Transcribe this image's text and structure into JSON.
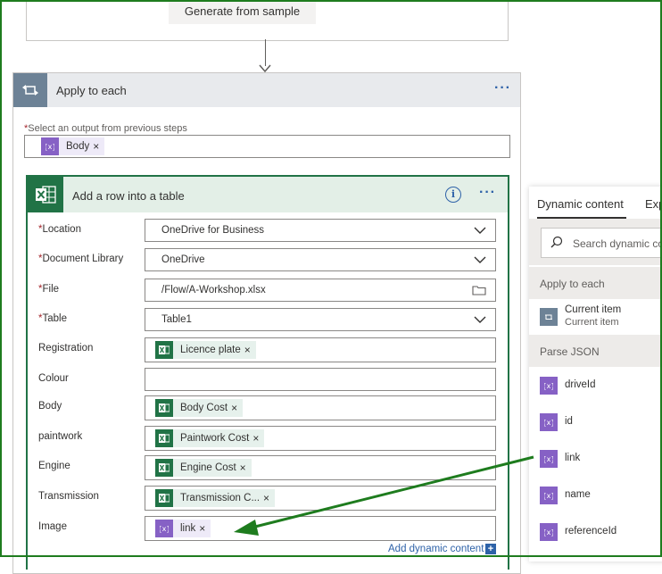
{
  "top_card": {
    "generate_label": "Generate from sample"
  },
  "apply_each": {
    "title": "Apply to each",
    "more_label": "···",
    "select_label": "Select an output from previous steps",
    "required_mark": "*",
    "token": {
      "label": "Body",
      "remove": "×"
    }
  },
  "add_row": {
    "title": "Add a row into a table",
    "info_label": "i",
    "more_label": "···",
    "fields": {
      "location": {
        "label": "Location",
        "value": "OneDrive for Business"
      },
      "document_library": {
        "label": "Document Library",
        "value": "OneDrive"
      },
      "file": {
        "label": "File",
        "value": "/Flow/A-Workshop.xlsx"
      },
      "table": {
        "label": "Table",
        "value": "Table1"
      },
      "registration": {
        "label": "Registration",
        "token": "Licence plate"
      },
      "colour": {
        "label": "Colour",
        "value": ""
      },
      "body": {
        "label": "Body",
        "token": "Body Cost"
      },
      "paintwork": {
        "label": "paintwork",
        "token": "Paintwork Cost"
      },
      "engine": {
        "label": "Engine",
        "token": "Engine Cost"
      },
      "transmission": {
        "label": "Transmission",
        "token": "Transmission C..."
      },
      "image": {
        "label": "Image",
        "token": "link"
      }
    },
    "token_remove": "×",
    "add_dynamic_label": "Add dynamic content",
    "add_plus": "+"
  },
  "dynamic_panel": {
    "tab_active": "Dynamic content",
    "tab_other": "Exp",
    "search_placeholder": "Search dynamic co",
    "sections": [
      {
        "title": "Apply to each"
      },
      {
        "title": "Parse JSON"
      }
    ],
    "current_item": {
      "name": "Current item",
      "sub": "Current item"
    },
    "items": [
      "driveId",
      "id",
      "link",
      "name",
      "referenceId"
    ]
  },
  "colors": {
    "accent_blue": "#2e62a8",
    "excel_green": "#217346",
    "expression_purple": "#8661c5",
    "annotation_arrow": "#1e7c1e"
  }
}
